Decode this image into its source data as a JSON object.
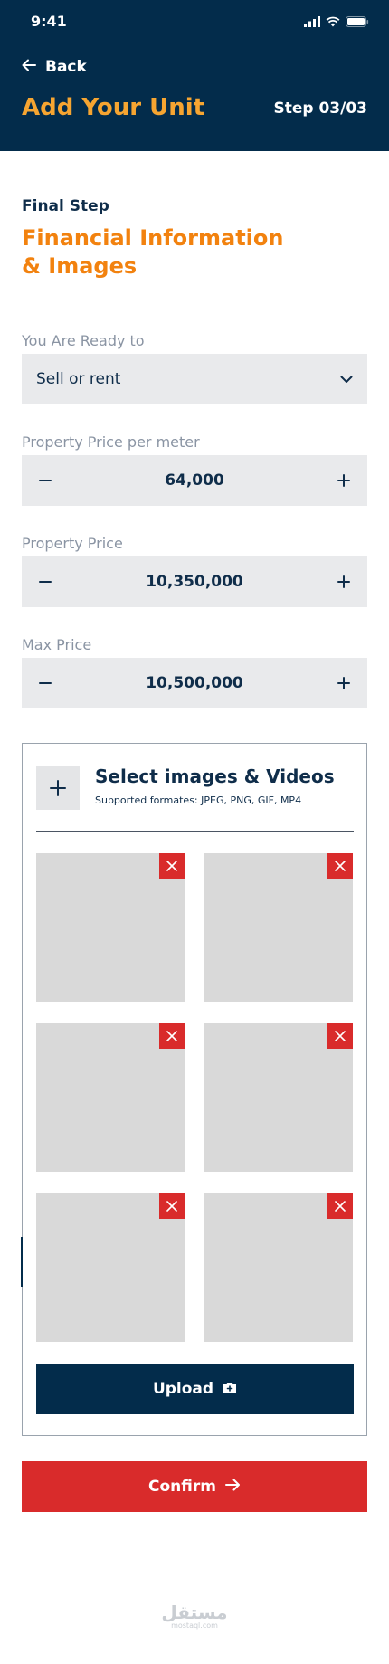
{
  "status_bar": {
    "time": "9:41"
  },
  "header": {
    "back_label": "Back",
    "title": "Add Your Unit",
    "step": "Step 03/03"
  },
  "section": {
    "label": "Final Step",
    "title": "Financial Information & Images"
  },
  "fields": {
    "ready_to": {
      "label": "You Are Ready to",
      "value": "Sell or rent"
    },
    "price_per_meter": {
      "label": "Property Price per meter",
      "value": "64,000"
    },
    "property_price": {
      "label": "Property Price",
      "value": "10,350,000"
    },
    "max_price": {
      "label": "Max Price",
      "value": "10,500,000"
    }
  },
  "upload": {
    "title": "Select images & Videos",
    "formats": "Supported formates: JPEG, PNG, GIF, MP4",
    "button_label": "Upload",
    "thumbnails_count": 6
  },
  "confirm_label": "Confirm",
  "watermark": {
    "main": "مستقل",
    "sub": "mostaql.com"
  },
  "colors": {
    "header_bg": "#032c4b",
    "title_accent": "#f6a531",
    "section_accent": "#f2820f",
    "danger": "#d92b2b",
    "field_bg": "#e9eaec"
  }
}
